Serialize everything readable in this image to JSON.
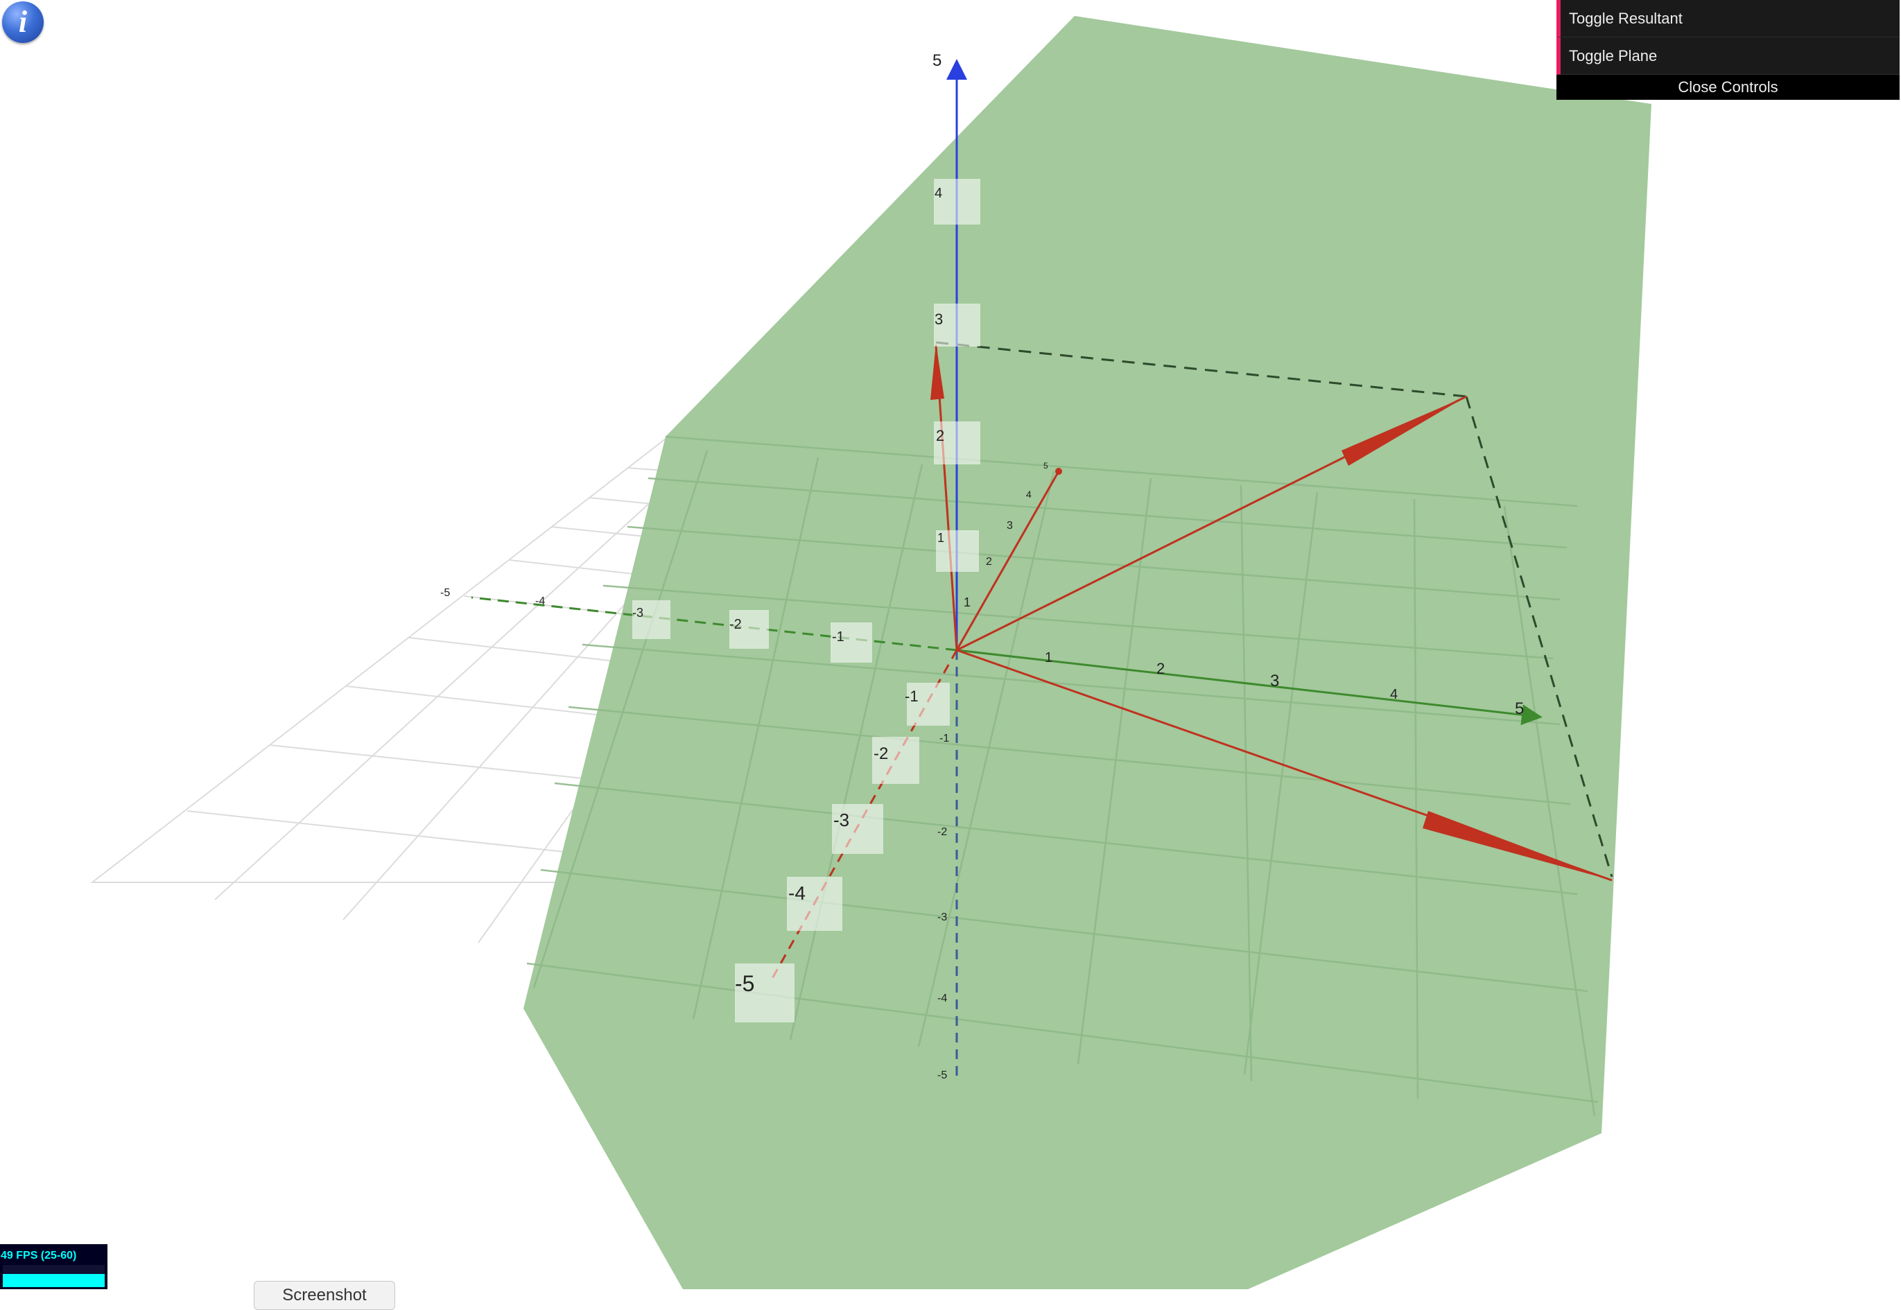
{
  "controls": {
    "toggle_resultant_label": "Toggle Resultant",
    "toggle_plane_label": "Toggle Plane",
    "close_label": "Close Controls"
  },
  "fps": {
    "text": "49 FPS (25-60)"
  },
  "screenshot": {
    "label": "Screenshot"
  },
  "axes": {
    "z_top_label": "5",
    "z_pos_ticks": [
      "4",
      "3",
      "2",
      "1"
    ],
    "z_neg_ticks": [
      "-1",
      "-2",
      "-3",
      "-4",
      "-5"
    ],
    "x_pos_ticks": [
      "1",
      "2",
      "3",
      "4",
      "5"
    ],
    "x_neg_ticks": [
      "-1",
      "-2",
      "-3",
      "-4",
      "-5"
    ],
    "y_pos_ticks": [
      "1",
      "2",
      "3",
      "4",
      "5"
    ],
    "y_neg_ticks": [
      "-1",
      "-2",
      "-3",
      "-4",
      "-5"
    ]
  },
  "colors": {
    "plane": "#a3c99c",
    "vector": "#c0311f",
    "z_axis": "#2a3fe0",
    "x_axis": "#3e8a2e",
    "info": "#3c6fd6",
    "panel_accent": "#e61d5f"
  }
}
